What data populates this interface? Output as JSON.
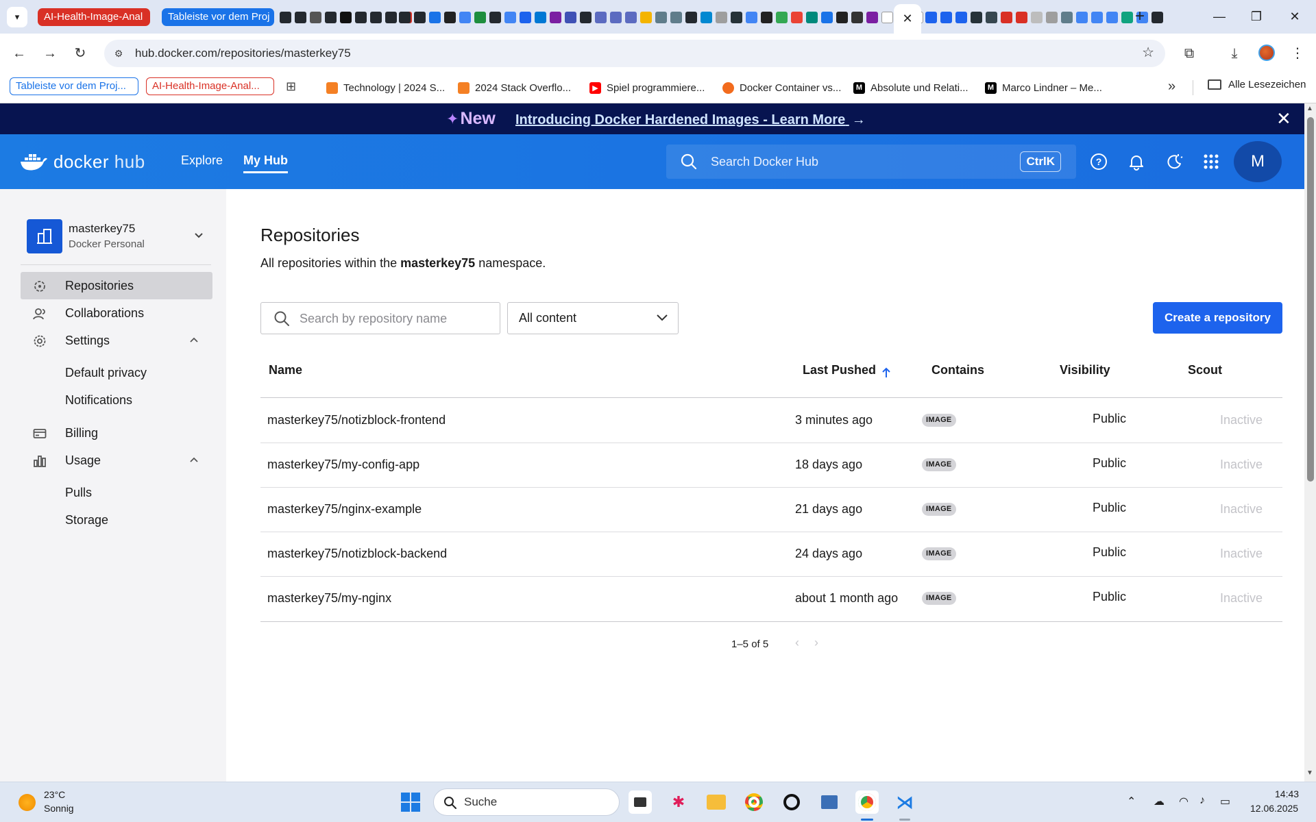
{
  "browser": {
    "tab_groups": [
      {
        "label": "AI-Health-Image-Anal",
        "color": "#d93025"
      },
      {
        "label": "Tableiste vor dem Proj",
        "color": "#1a73e8"
      }
    ],
    "active_tab_close": "✕",
    "new_tab": "+",
    "window_controls": {
      "minimize": "—",
      "maximize": "❐",
      "close": "✕"
    },
    "url": "hub.docker.com/repositories/masterkey75",
    "bookmark_groups": [
      {
        "label": "Tableiste vor dem Proj...",
        "color": "#1a73e8"
      },
      {
        "label": "AI-Health-Image-Anal...",
        "color": "#d93025"
      }
    ],
    "bookmarks": [
      {
        "label": "Technology | 2024 S...",
        "icon": "stackoverflow-icon"
      },
      {
        "label": "2024 Stack Overflo...",
        "icon": "stackoverflow-icon"
      },
      {
        "label": "Spiel programmiere...",
        "icon": "youtube-icon"
      },
      {
        "label": "Docker Container vs...",
        "icon": "docker-blog-icon"
      },
      {
        "label": "Absolute und Relati...",
        "icon": "medium-icon"
      },
      {
        "label": "Marco Lindner – Me...",
        "icon": "medium-icon"
      }
    ],
    "bookmarks_more": "»",
    "all_bookmarks": "Alle Lesezeichen"
  },
  "announcement": {
    "badge": "New",
    "text": "Introducing Docker Hardened Images - Learn More",
    "arrow": "→",
    "close": "✕"
  },
  "header": {
    "logo_docker": "docker",
    "logo_hub": "hub",
    "nav": [
      {
        "label": "Explore",
        "active": false
      },
      {
        "label": "My Hub",
        "active": true
      }
    ],
    "search_placeholder": "Search Docker Hub",
    "search_shortcut": "CtrlK",
    "avatar_letter": "M",
    "accent": "#1d6fe1"
  },
  "sidebar": {
    "org_name": "masterkey75",
    "org_type": "Docker Personal",
    "items": [
      {
        "label": "Repositories",
        "icon": "repositories-icon",
        "selected": true
      },
      {
        "label": "Collaborations",
        "icon": "collaborations-icon"
      },
      {
        "label": "Settings",
        "icon": "gear-icon",
        "expanded": true
      },
      {
        "label": "Billing",
        "icon": "billing-icon"
      },
      {
        "label": "Usage",
        "icon": "usage-chart-icon",
        "expanded": true
      }
    ],
    "settings_sub": [
      "Default privacy",
      "Notifications"
    ],
    "usage_sub": [
      "Pulls",
      "Storage"
    ]
  },
  "main": {
    "title": "Repositories",
    "desc_prefix": "All repositories within the ",
    "desc_namespace": "masterkey75",
    "desc_suffix": " namespace.",
    "search_placeholder": "Search by repository name",
    "filter_value": "All content",
    "create_button": "Create a repository",
    "columns": {
      "name": "Name",
      "last_pushed": "Last Pushed",
      "contains": "Contains",
      "visibility": "Visibility",
      "scout": "Scout"
    },
    "rows": [
      {
        "name": "masterkey75/notizblock-frontend",
        "pushed": "3 minutes ago",
        "contains": "IMAGE",
        "visibility": "Public",
        "scout": "Inactive"
      },
      {
        "name": "masterkey75/my-config-app",
        "pushed": "18 days ago",
        "contains": "IMAGE",
        "visibility": "Public",
        "scout": "Inactive"
      },
      {
        "name": "masterkey75/nginx-example",
        "pushed": "21 days ago",
        "contains": "IMAGE",
        "visibility": "Public",
        "scout": "Inactive"
      },
      {
        "name": "masterkey75/notizblock-backend",
        "pushed": "24 days ago",
        "contains": "IMAGE",
        "visibility": "Public",
        "scout": "Inactive"
      },
      {
        "name": "masterkey75/my-nginx",
        "pushed": "about 1 month ago",
        "contains": "IMAGE",
        "visibility": "Public",
        "scout": "Inactive"
      }
    ],
    "pagination": "1–5 of 5",
    "prev": "‹",
    "next": "›"
  },
  "taskbar": {
    "weather_temp": "23°C",
    "weather_desc": "Sonnig",
    "search_label": "Suche",
    "time": "14:43",
    "date": "12.06.2025"
  }
}
